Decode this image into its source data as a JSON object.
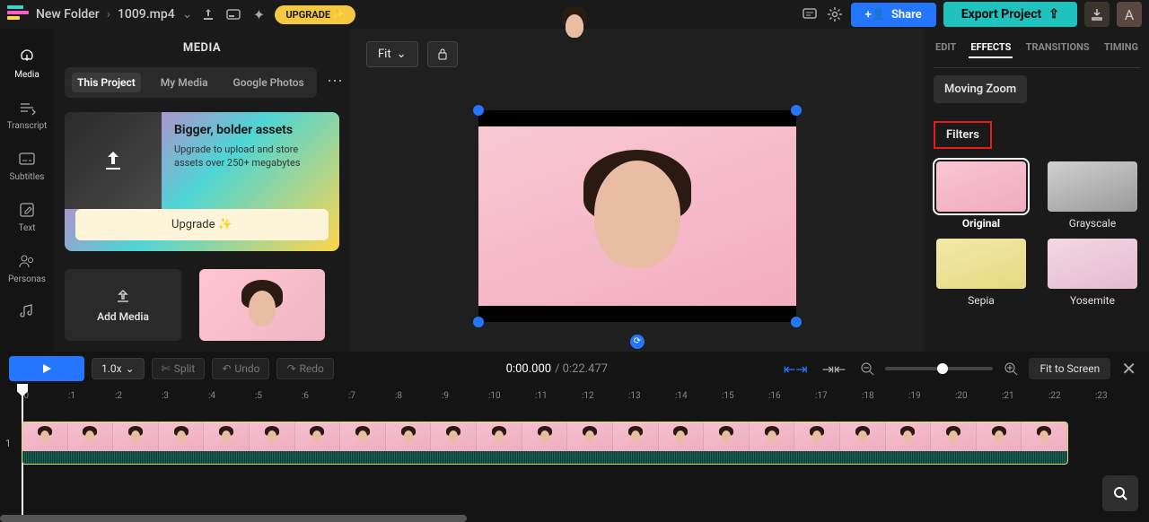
{
  "topbar": {
    "folder": "New Folder",
    "file": "1009.mp4",
    "upgrade": "UPGRADE ✨",
    "share": "Share",
    "export": "Export Project"
  },
  "sidenav": {
    "media": "Media",
    "transcript": "Transcript",
    "subtitles": "Subtitles",
    "text": "Text",
    "personas": "Personas"
  },
  "mediaPanel": {
    "title": "MEDIA",
    "tabs": {
      "thisProject": "This Project",
      "myMedia": "My Media",
      "googlePhotos": "Google Photos"
    },
    "upgradeCard": {
      "title": "Bigger, bolder assets",
      "desc": "Upgrade to upload and store assets over 250+ megabytes",
      "btn": "Upgrade ✨"
    },
    "addMedia": "Add Media"
  },
  "preview": {
    "fit": "Fit"
  },
  "effects": {
    "tabs": {
      "edit": "EDIT",
      "effects": "EFFECTS",
      "transitions": "TRANSITIONS",
      "timing": "TIMING"
    },
    "movingZoom": "Moving Zoom",
    "filtersTitle": "Filters",
    "filters": {
      "original": "Original",
      "grayscale": "Grayscale",
      "sepia": "Sepia",
      "yosemite": "Yosemite"
    }
  },
  "controls": {
    "speed": "1.0x",
    "split": "Split",
    "undo": "Undo",
    "redo": "Redo",
    "current": "0:00.000",
    "duration": "0:22.477",
    "fitScreen": "Fit to Screen"
  },
  "timeline": {
    "ticks": [
      ":0",
      ":1",
      ":2",
      ":3",
      ":4",
      ":5",
      ":6",
      ":7",
      ":8",
      ":9",
      ":10",
      ":11",
      ":12",
      ":13",
      ":14",
      ":15",
      ":16",
      ":17",
      ":18",
      ":19",
      ":20",
      ":21",
      ":22",
      ":23"
    ],
    "trackNum": "1"
  }
}
